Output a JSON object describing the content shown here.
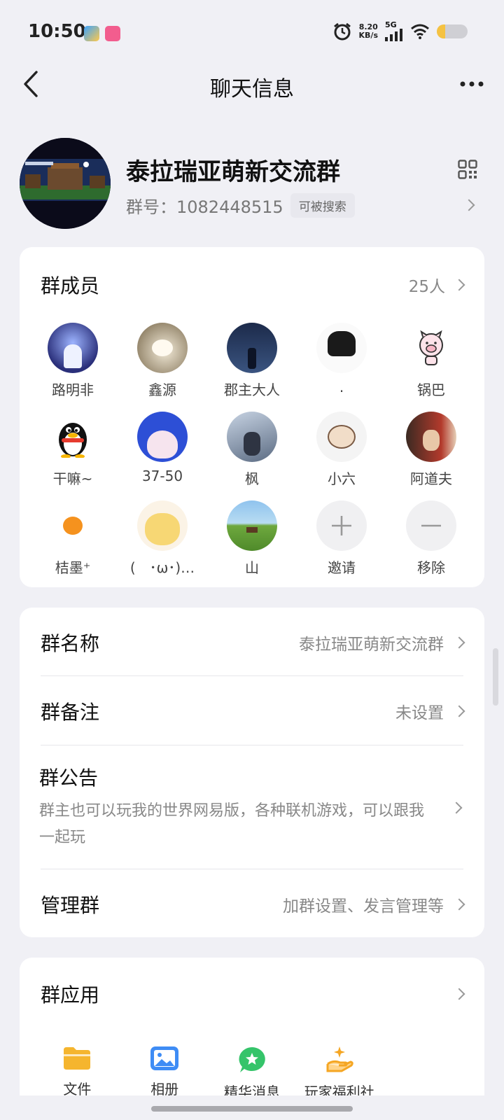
{
  "status_bar": {
    "time": "10:50",
    "network_speed_value": "8.20",
    "network_speed_unit": "KB/s",
    "network_type": "5G",
    "battery_level": 0.28
  },
  "header": {
    "title": "聊天信息"
  },
  "group": {
    "name": "泰拉瑞亚萌新交流群",
    "id_text": "群号：1082448515",
    "searchable_badge": "可被搜索"
  },
  "members": {
    "title": "群成员",
    "count": "25人",
    "list": [
      {
        "name": "路明非"
      },
      {
        "name": "鑫源"
      },
      {
        "name": "郡主大人"
      },
      {
        "name": "."
      },
      {
        "name": "锅巴"
      },
      {
        "name": "干嘛~"
      },
      {
        "name": "37-50"
      },
      {
        "name": "枫"
      },
      {
        "name": "小六"
      },
      {
        "name": "阿道夫"
      },
      {
        "name": "桔墨⁺"
      },
      {
        "name": "(　･ω･)…"
      },
      {
        "name": "山"
      }
    ],
    "invite_label": "邀请",
    "remove_label": "移除"
  },
  "settings": {
    "group_name_label": "群名称",
    "group_name_value": "泰拉瑞亚萌新交流群",
    "group_remark_label": "群备注",
    "group_remark_value": "未设置",
    "announcement_label": "群公告",
    "announcement_text": "群主也可以玩我的世界网易版，各种联机游戏，可以跟我一起玩",
    "manage_label": "管理群",
    "manage_value": "加群设置、发言管理等"
  },
  "group_apps": {
    "title": "群应用",
    "items": [
      {
        "label": "文件",
        "icon": "folder-icon"
      },
      {
        "label": "相册",
        "icon": "album-icon"
      },
      {
        "label": "精华消息",
        "icon": "essence-icon"
      },
      {
        "label": "玩家福利社",
        "icon": "welfare-icon"
      }
    ]
  },
  "colors": {
    "background": "#f0f0f5",
    "card": "#ffffff",
    "folder": "#f5b52e",
    "album": "#3e8cf5",
    "essence": "#35c46a",
    "welfare": "#f5a623"
  }
}
